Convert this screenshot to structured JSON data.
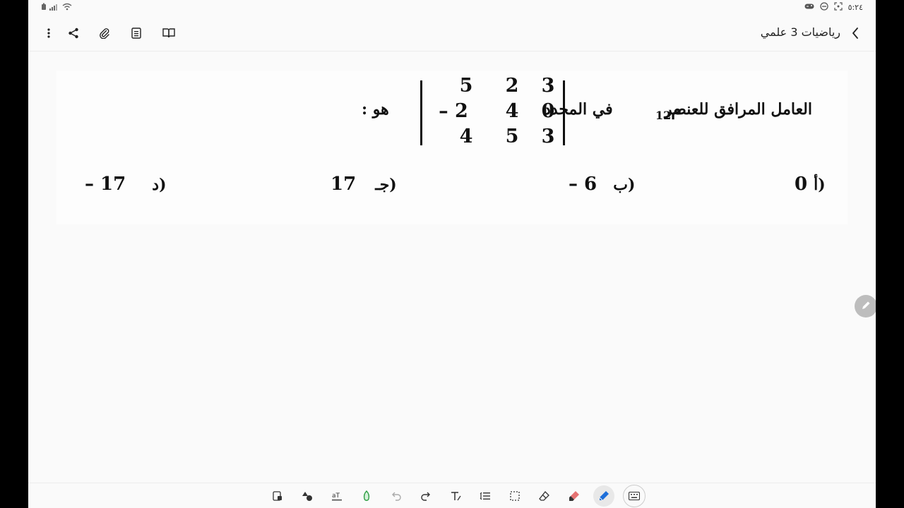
{
  "status_bar": {
    "time": "٥:٢٤"
  },
  "app_bar": {
    "title": "رياضيات 3 علمي"
  },
  "question": {
    "text_start": "العامل المرافق للعنصر",
    "element": "م",
    "element_sub": "12",
    "text_mid": "في المحدد",
    "text_end": "هو :",
    "matrix": [
      [
        "3",
        "2",
        "5"
      ],
      [
        "0",
        "4",
        "– 2"
      ],
      [
        "3",
        "5",
        "4"
      ]
    ]
  },
  "options": [
    {
      "letter": "أ)",
      "value": "0"
    },
    {
      "letter": "ب)",
      "value": "– 6"
    },
    {
      "letter": "جـ)",
      "value": "17"
    },
    {
      "letter": "د)",
      "value": "– 17"
    }
  ],
  "colors": {
    "background": "#fafafa",
    "text": "#111111",
    "fab": "#bdbdbd",
    "highlighter": "#e57373",
    "pen": "#1e6fd9"
  },
  "toolbar_icons": [
    "page-add-icon",
    "shapes-icon",
    "text-format-icon",
    "lasso-icon",
    "undo-icon",
    "redo-icon",
    "text-tool-icon",
    "line-spacing-icon",
    "selection-icon",
    "eraser-icon",
    "highlighter-icon",
    "pen-icon",
    "keyboard-icon"
  ]
}
